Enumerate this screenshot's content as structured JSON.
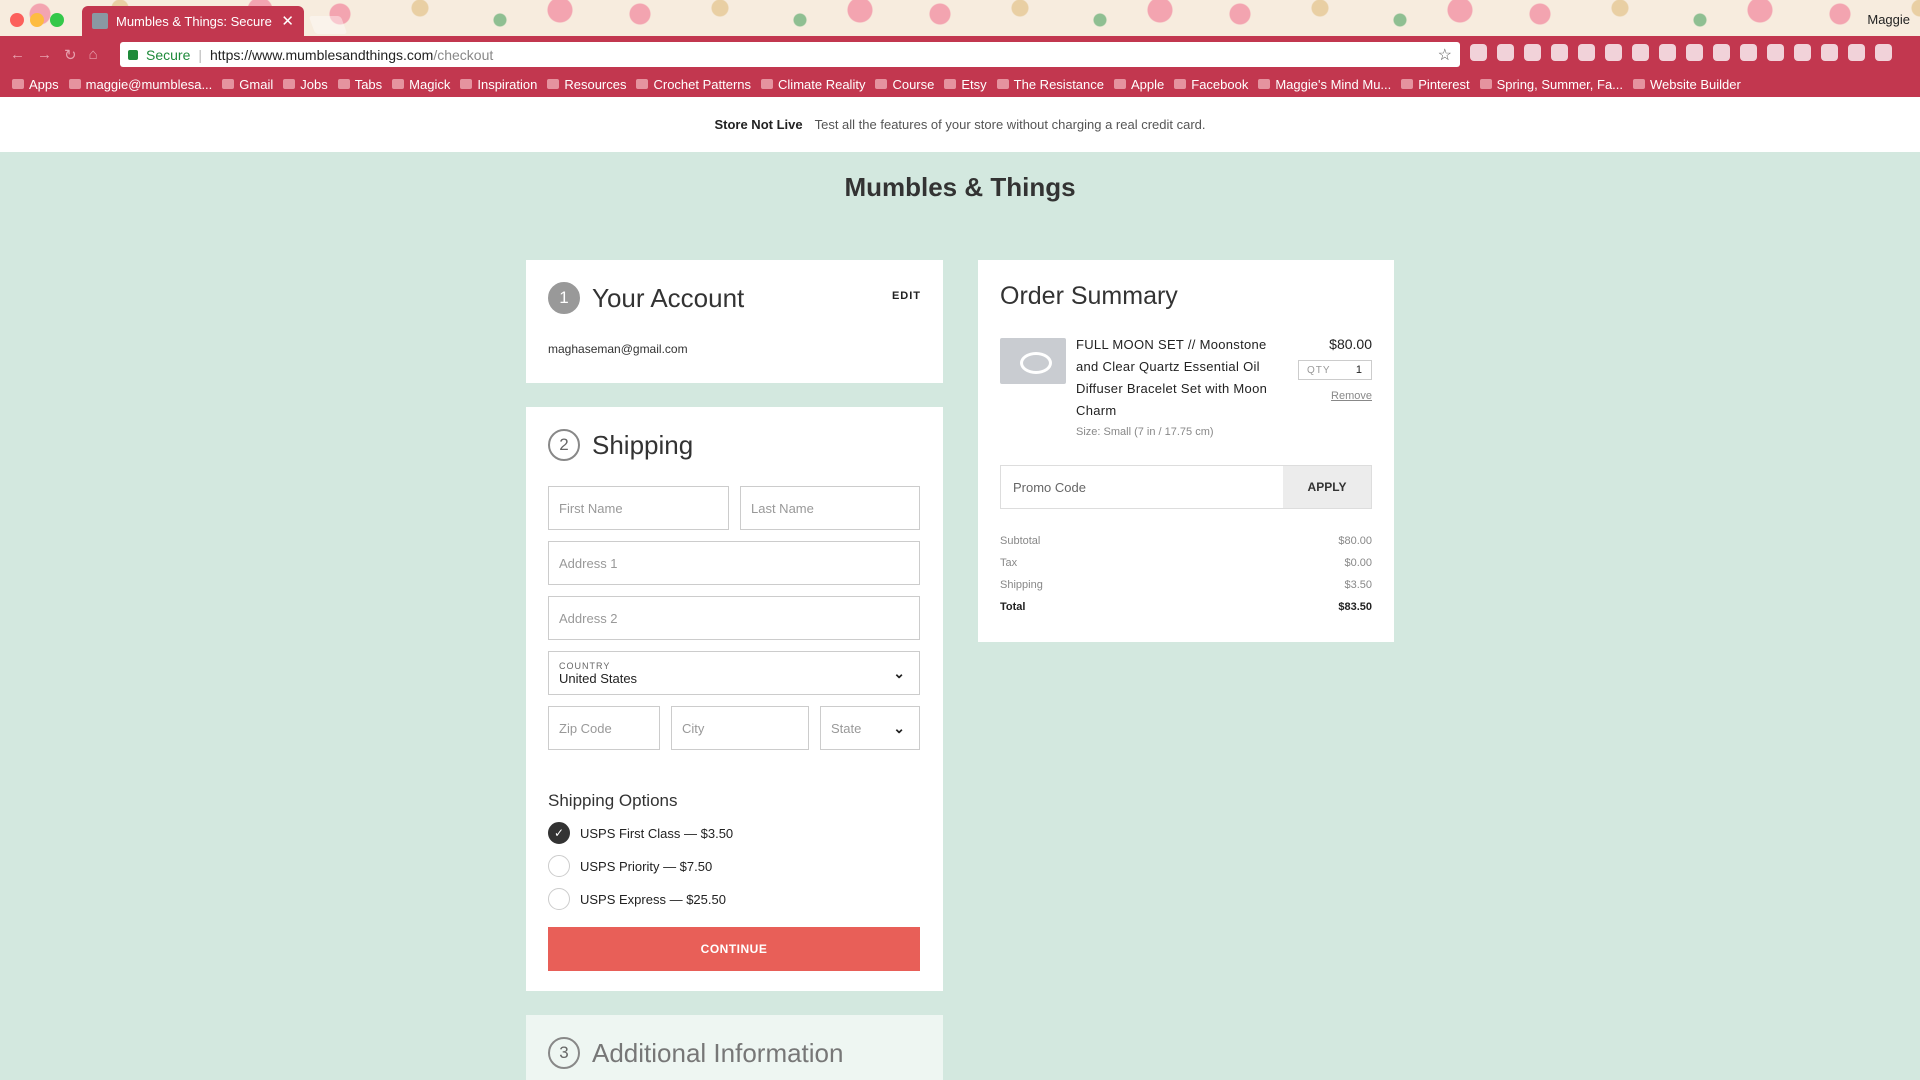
{
  "browser": {
    "tab_title": "Mumbles & Things: Secure Ch",
    "user": "Maggie",
    "secure_label": "Secure",
    "url_domain": "https://www.mumblesandthings.com",
    "url_path": "/checkout",
    "bookmarks": [
      "Apps",
      "maggie@mumblesa...",
      "Gmail",
      "Jobs",
      "Tabs",
      "Magick",
      "Inspiration",
      "Resources",
      "Crochet Patterns",
      "Climate Reality",
      "Course",
      "Etsy",
      "The Resistance",
      "Apple",
      "Facebook",
      "Maggie's Mind Mu...",
      "Pinterest",
      "Spring, Summer, Fa...",
      "Website Builder"
    ]
  },
  "banner": {
    "title": "Store Not Live",
    "text": "Test all the features of your store without charging a real credit card."
  },
  "store": {
    "name": "Mumbles & Things"
  },
  "account": {
    "step": "1",
    "title": "Your Account",
    "edit": "EDIT",
    "email": "maghaseman@gmail.com"
  },
  "shipping": {
    "step": "2",
    "title": "Shipping",
    "first_name": "First Name",
    "last_name": "Last Name",
    "address1": "Address 1",
    "address2": "Address 2",
    "country_label": "COUNTRY",
    "country_value": "United States",
    "zip": "Zip Code",
    "city": "City",
    "state": "State",
    "options_title": "Shipping Options",
    "options": [
      {
        "label": "USPS First Class — $3.50",
        "selected": true
      },
      {
        "label": "USPS Priority — $7.50",
        "selected": false
      },
      {
        "label": "USPS Express — $25.50",
        "selected": false
      }
    ],
    "continue": "CONTINUE"
  },
  "additional": {
    "step": "3",
    "title": "Additional Information"
  },
  "summary": {
    "title": "Order Summary",
    "product": {
      "name": "FULL MOON SET // Moonstone and Clear Quartz Essential Oil Diffuser Bracelet Set with Moon Charm",
      "size": "Size: Small (7 in / 17.75 cm)",
      "price": "$80.00",
      "qty_label": "QTY",
      "qty": "1",
      "remove": "Remove"
    },
    "promo_placeholder": "Promo Code",
    "apply": "APPLY",
    "rows": [
      {
        "label": "Subtotal",
        "value": "$80.00"
      },
      {
        "label": "Tax",
        "value": "$0.00"
      },
      {
        "label": "Shipping",
        "value": "$3.50"
      },
      {
        "label": "Total",
        "value": "$83.50"
      }
    ]
  }
}
